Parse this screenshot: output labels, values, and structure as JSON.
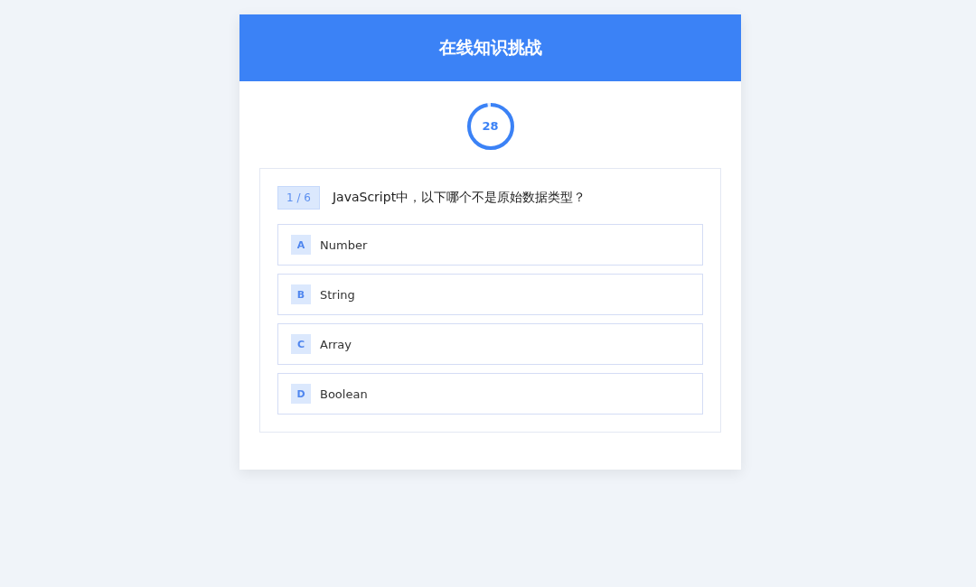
{
  "header": {
    "title": "在线知识挑战"
  },
  "timer": {
    "reading": "28",
    "level": 0.97
  },
  "question": {
    "counter": "1 / 6",
    "text": "JavaScript中，以下哪个不是原始数据类型？"
  },
  "options": [
    {
      "letter": "A",
      "text": "Number",
      "selected": false
    },
    {
      "letter": "B",
      "text": "String",
      "selected": false
    },
    {
      "letter": "C",
      "text": "Array",
      "selected": false
    },
    {
      "letter": "D",
      "text": "Boolean",
      "selected": false
    }
  ]
}
